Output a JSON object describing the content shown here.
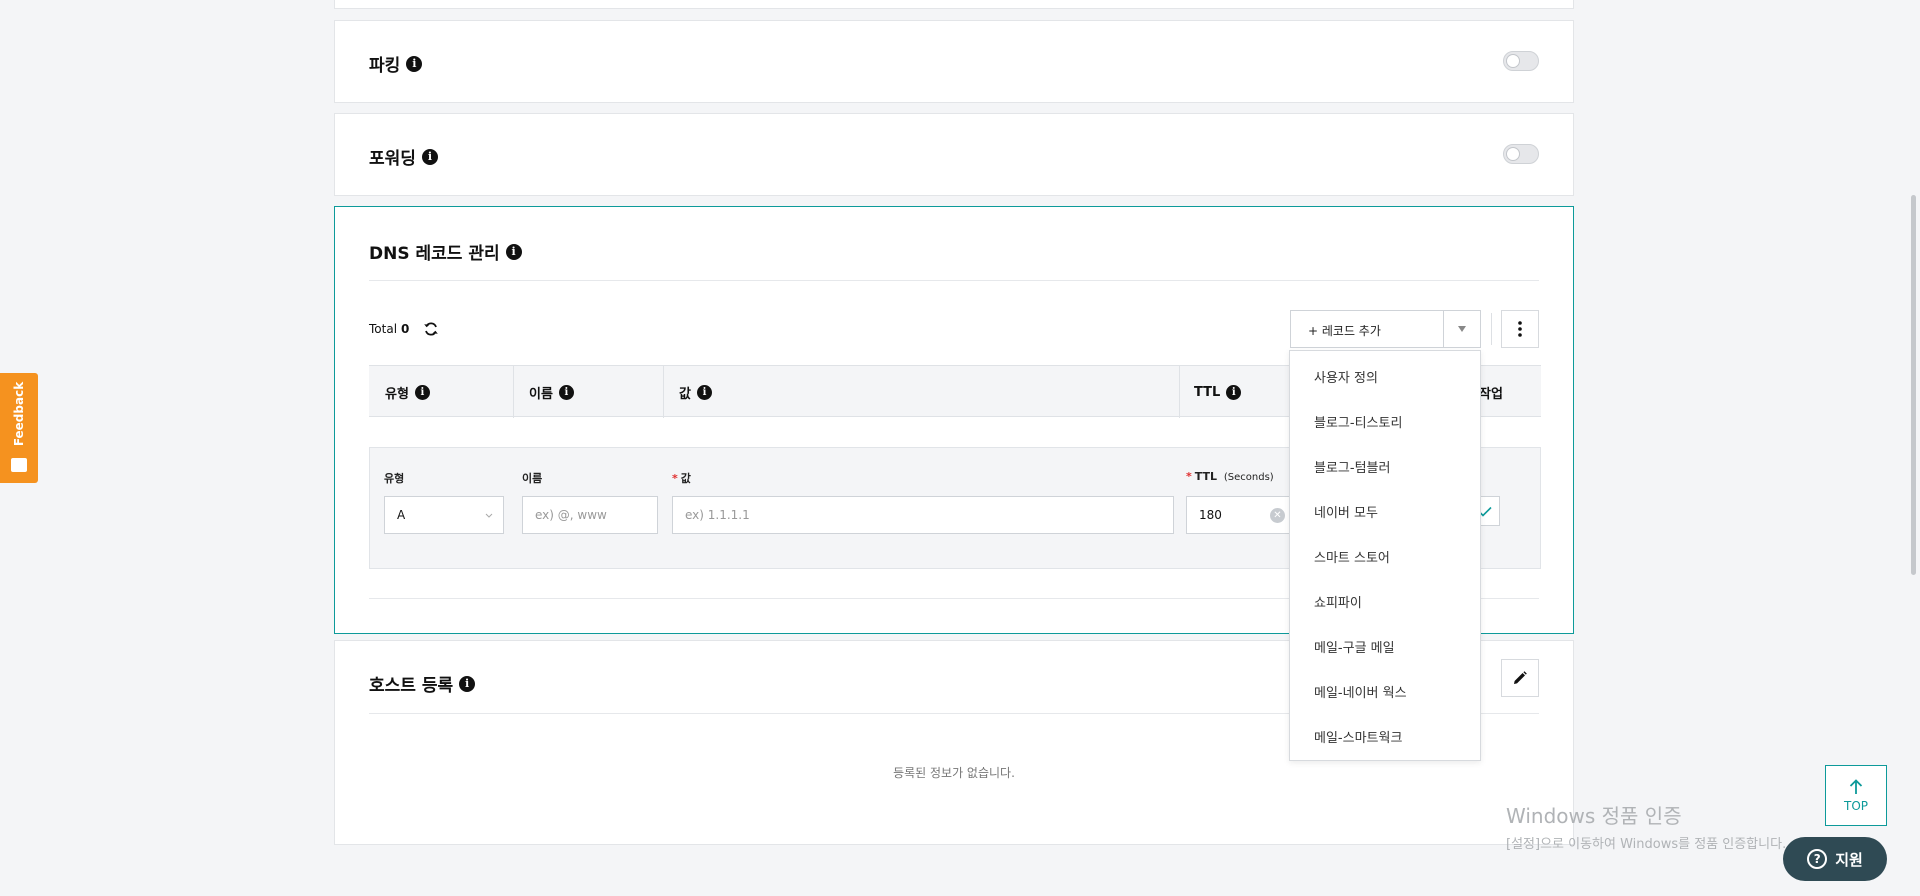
{
  "feedback": {
    "label": "Feedback"
  },
  "sections": {
    "parking": {
      "title": "파킹"
    },
    "forwarding": {
      "title": "포워딩"
    },
    "dns": {
      "title": "DNS 레코드 관리",
      "total_label": "Total",
      "total_count": "0",
      "add_record_label": "+ 레코드 추가",
      "table_headers": {
        "type": "유형",
        "name": "이름",
        "value": "값",
        "ttl": "TTL",
        "actions": "작업"
      },
      "form": {
        "type_label": "유형",
        "type_value": "A",
        "name_label": "이름",
        "name_placeholder": "ex) @, www",
        "value_label": "값",
        "value_placeholder": "ex) 1.1.1.1",
        "ttl_label": "TTL",
        "ttl_unit": "(Seconds)",
        "ttl_value": "180"
      }
    },
    "host": {
      "title": "호스트 등록",
      "empty_text": "등록된 정보가 없습니다."
    }
  },
  "record_menu": {
    "items": [
      "사용자 정의",
      "블로그-티스토리",
      "블로그-텀블러",
      "네이버 모두",
      "스마트 스토어",
      "쇼피파이",
      "메일-구글 메일",
      "메일-네이버 웍스",
      "메일-스마트웍크"
    ]
  },
  "top_button": {
    "label": "TOP"
  },
  "support_button": {
    "label": "지원"
  },
  "watermark": {
    "line1": "Windows 정품 인증",
    "line2": "[설정]으로 이동하여 Windows를 정품 인증합니다."
  },
  "colors": {
    "accent": "#0d9a9a",
    "feedback": "#f5921f",
    "support": "#2f4a54"
  }
}
